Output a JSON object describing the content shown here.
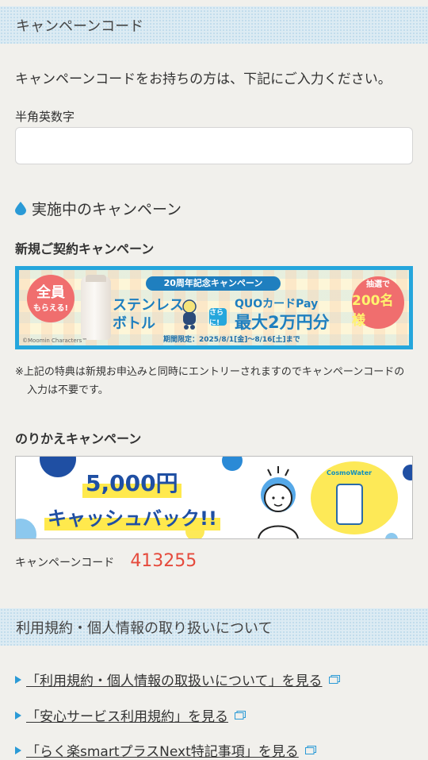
{
  "code_section": {
    "heading": "キャンペーンコード",
    "intro": "キャンペーンコードをお持ちの方は、下記にご入力ください。",
    "field_label": "半角英数字",
    "input_value": ""
  },
  "active_campaigns": {
    "heading": "実施中のキャンペーン",
    "new_contract": {
      "title": "新規ご契約キャンペーン",
      "banner": {
        "badge_big": "全員",
        "badge_small": "もらえる!",
        "anniversary": "20周年記念キャンペーン",
        "item_line1": "ステンレス",
        "item_line2": "ボトル",
        "plus_label": "さらに!",
        "quo": "QUOカードPay",
        "max_amount": "最大2万円分",
        "period": "期間限定：2025/8/1[金]〜8/16[土]まで",
        "lottery_a": "抽選で",
        "lottery_b": "200名様",
        "copyright": "©Moomin Characters™"
      },
      "note": "※上記の特典は新規お申込みと同時にエントリーされますのでキャンペーンコードの入力は不要です。"
    },
    "switch": {
      "title": "のりかえキャンペーン",
      "banner": {
        "amount": "5,000円",
        "cashback": "キャッシュバック!!",
        "logo": "CosmoWater"
      },
      "code_label": "キャンペーンコード",
      "code_value": "413255"
    }
  },
  "terms_section": {
    "heading": "利用規約・個人情報の取り扱いについて",
    "links": [
      "「利用規約・個人情報の取扱いについて」を見る",
      "「安心サービス利用規約」を見る",
      "「らく楽smartプラスNext特記事項」を見る"
    ]
  },
  "colors": {
    "accent": "#2a9ad6",
    "code_value": "#e54a3c",
    "banner_border": "#25a6dc"
  }
}
